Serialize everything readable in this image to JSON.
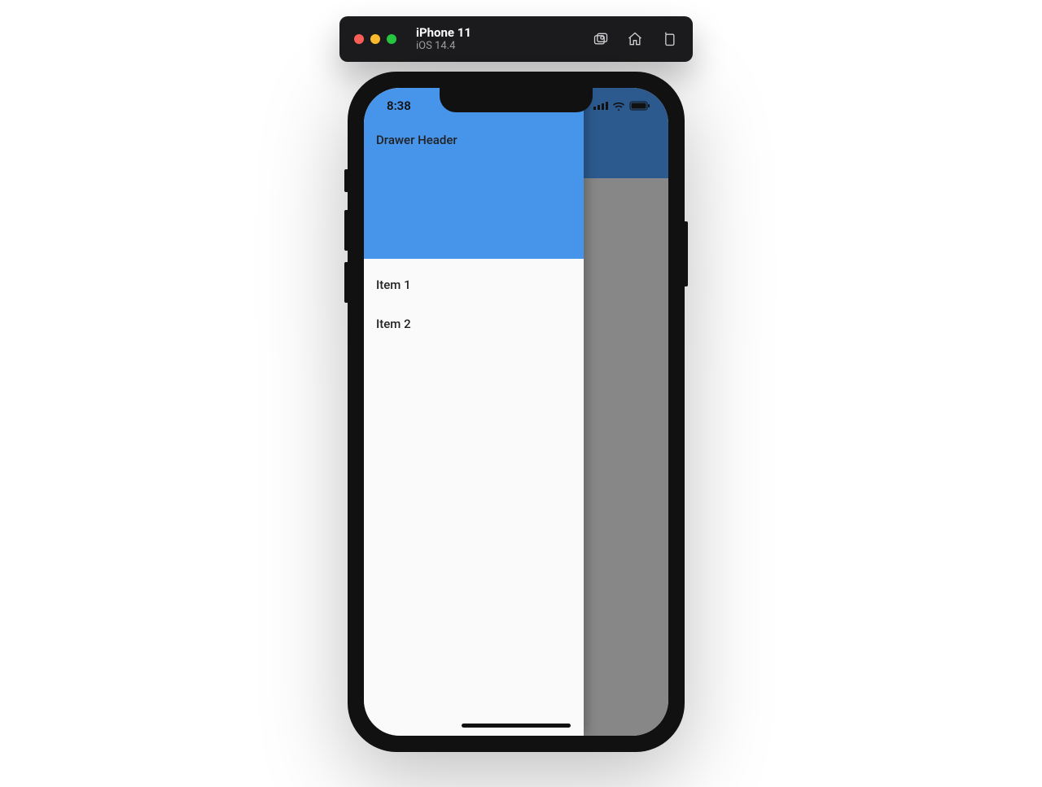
{
  "simulator": {
    "device": "iPhone 11",
    "os": "iOS 14.4"
  },
  "status_bar": {
    "time": "8:38"
  },
  "drawer": {
    "header": "Drawer Header",
    "items": [
      "Item 1",
      "Item 2"
    ]
  }
}
